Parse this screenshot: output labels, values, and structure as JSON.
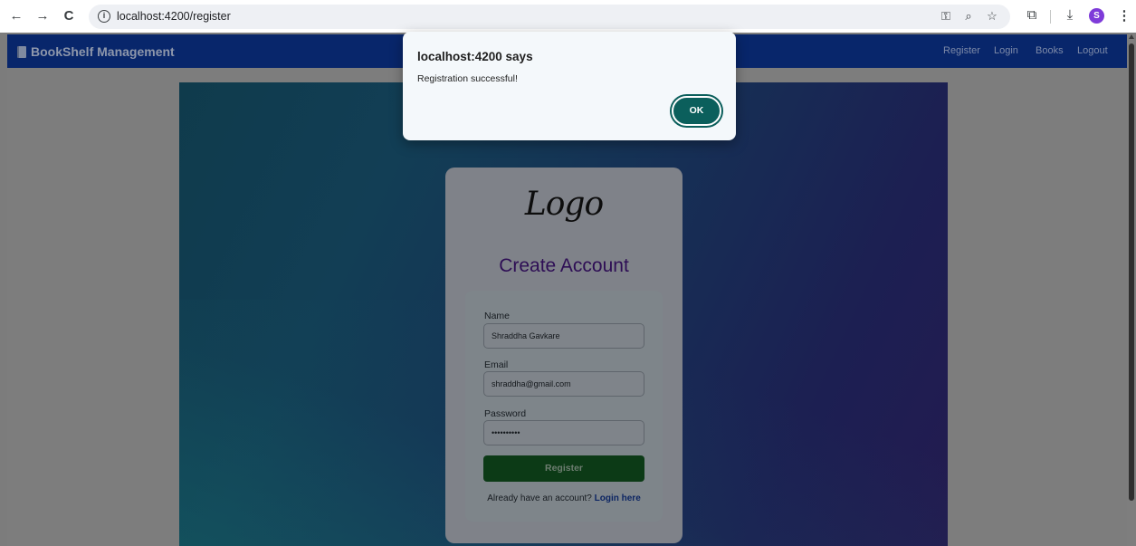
{
  "browser": {
    "url": "localhost:4200/register",
    "back_icon": "←",
    "forward_icon": "→",
    "reload_icon": "C",
    "info_icon": "i",
    "profile_initial": "S"
  },
  "navbar": {
    "brand": "BookShelf Management",
    "links": [
      "Register",
      "Login",
      "Books",
      "Logout"
    ]
  },
  "card": {
    "logo_text": "Logo",
    "title": "Create Account",
    "fields": {
      "name_label": "Name",
      "name_value": "Shraddha Gavkare",
      "email_label": "Email",
      "email_value": "shraddha@gmail.com",
      "password_label": "Password",
      "password_value": "••••••••••"
    },
    "register_label": "Register",
    "login_prompt": "Already have an account?",
    "login_link": "Login here"
  },
  "dialog": {
    "title": "localhost:4200 says",
    "message": "Registration successful!",
    "ok_label": "OK"
  },
  "colors": {
    "navbar": "#08266b",
    "accent_dialog_button": "#0b5f5c",
    "register_button": "#0c3a16",
    "profile": "#7e3bd9"
  }
}
